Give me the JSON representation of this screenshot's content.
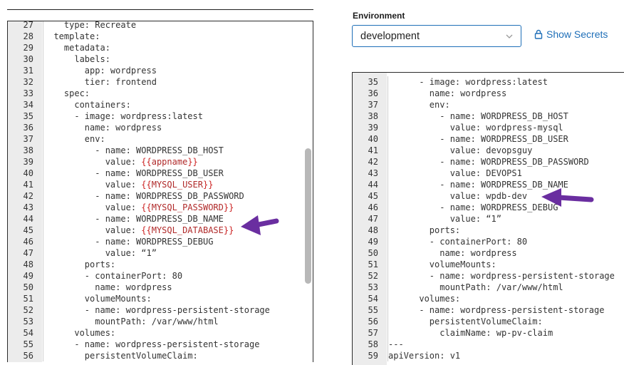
{
  "colors": {
    "accent": "#1f6fb8",
    "arrow": "#6a2ea0",
    "template_var": "#b02a2a"
  },
  "environment": {
    "label": "Environment",
    "selected": "development",
    "chevron_icon": "chevron-down-icon"
  },
  "secrets": {
    "label": "Show Secrets",
    "icon": "lock-icon"
  },
  "left_editor": {
    "lines": [
      {
        "num": "27",
        "text": "    type: Recreate"
      },
      {
        "num": "28",
        "text": "  template:"
      },
      {
        "num": "29",
        "text": "    metadata:"
      },
      {
        "num": "30",
        "text": "      labels:"
      },
      {
        "num": "31",
        "text": "        app: wordpress"
      },
      {
        "num": "32",
        "text": "        tier: frontend"
      },
      {
        "num": "33",
        "text": "    spec:"
      },
      {
        "num": "34",
        "text": "      containers:"
      },
      {
        "num": "35",
        "text": "      - image: wordpress:latest"
      },
      {
        "num": "36",
        "text": "        name: wordpress"
      },
      {
        "num": "37",
        "text": "        env:"
      },
      {
        "num": "38",
        "text": "          - name: WORDPRESS_DB_HOST"
      },
      {
        "num": "39",
        "text": "            value: ",
        "var": "appname"
      },
      {
        "num": "40",
        "text": "          - name: WORDPRESS_DB_USER"
      },
      {
        "num": "41",
        "text": "            value: ",
        "var": "MYSQL_USER"
      },
      {
        "num": "42",
        "text": "          - name: WORDPRESS_DB_PASSWORD"
      },
      {
        "num": "43",
        "text": "            value: ",
        "var": "MYSQL_PASSWORD"
      },
      {
        "num": "44",
        "text": "          - name: WORDPRESS_DB_NAME"
      },
      {
        "num": "45",
        "text": "            value: ",
        "var": "MYSQL_DATABASE"
      },
      {
        "num": "46",
        "text": "          - name: WORDPRESS_DEBUG"
      },
      {
        "num": "47",
        "text": "            value: “1”"
      },
      {
        "num": "48",
        "text": "        ports:"
      },
      {
        "num": "49",
        "text": "        - containerPort: 80"
      },
      {
        "num": "50",
        "text": "          name: wordpress"
      },
      {
        "num": "51",
        "text": "        volumeMounts:"
      },
      {
        "num": "52",
        "text": "        - name: wordpress-persistent-storage"
      },
      {
        "num": "53",
        "text": "          mountPath: /var/www/html"
      },
      {
        "num": "54",
        "text": "      volumes:"
      },
      {
        "num": "55",
        "text": "      - name: wordpress-persistent-storage"
      },
      {
        "num": "56",
        "text": "        persistentVolumeClaim:"
      }
    ]
  },
  "right_editor": {
    "lines": [
      {
        "num": "35",
        "text": "      - image: wordpress:latest"
      },
      {
        "num": "36",
        "text": "        name: wordpress"
      },
      {
        "num": "37",
        "text": "        env:"
      },
      {
        "num": "38",
        "text": "          - name: WORDPRESS_DB_HOST"
      },
      {
        "num": "39",
        "text": "            value: wordpress-mysql"
      },
      {
        "num": "40",
        "text": "          - name: WORDPRESS_DB_USER"
      },
      {
        "num": "41",
        "text": "            value: devopsguy"
      },
      {
        "num": "42",
        "text": "          - name: WORDPRESS_DB_PASSWORD"
      },
      {
        "num": "43",
        "text": "            value: DEVOPS1"
      },
      {
        "num": "44",
        "text": "          - name: WORDPRESS_DB_NAME"
      },
      {
        "num": "45",
        "text": "            value: wpdb-dev"
      },
      {
        "num": "46",
        "text": "          - name: WORDPRESS_DEBUG"
      },
      {
        "num": "47",
        "text": "            value: “1”"
      },
      {
        "num": "48",
        "text": "        ports:"
      },
      {
        "num": "49",
        "text": "        - containerPort: 80"
      },
      {
        "num": "50",
        "text": "          name: wordpress"
      },
      {
        "num": "51",
        "text": "        volumeMounts:"
      },
      {
        "num": "52",
        "text": "        - name: wordpress-persistent-storage"
      },
      {
        "num": "53",
        "text": "          mountPath: /var/www/html"
      },
      {
        "num": "54",
        "text": "      volumes:"
      },
      {
        "num": "55",
        "text": "      - name: wordpress-persistent-storage"
      },
      {
        "num": "56",
        "text": "        persistentVolumeClaim:"
      },
      {
        "num": "57",
        "text": "          claimName: wp-pv-claim"
      },
      {
        "num": "58",
        "text": "---"
      },
      {
        "num": "59",
        "text": "apiVersion: v1"
      }
    ]
  }
}
